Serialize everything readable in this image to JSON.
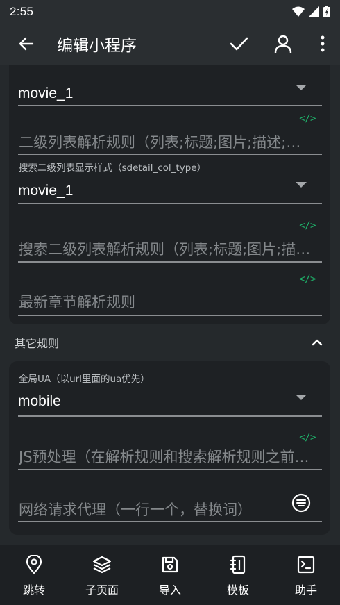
{
  "status_bar": {
    "time": "2:55"
  },
  "app_bar": {
    "title": "编辑小程序"
  },
  "card1": {
    "top_value": "movie_1",
    "rule_placeholder": "二级列表解析规则（列表;标题;图片;描述;链接）",
    "search_style_label": "搜索二级列表显示样式（sdetail_col_type）",
    "search_style_value": "movie_1",
    "search_rule_placeholder": "搜索二级列表解析规则（列表;标题;图片;描述;链接）",
    "latest_chapter_placeholder": "最新章节解析规则"
  },
  "code_icon_text": "</>",
  "section": {
    "title": "其它规则"
  },
  "card2": {
    "ua_label": "全局UA（以url里面的ua优先）",
    "ua_value": "mobile",
    "js_placeholder": "JS预处理（在解析规则和搜索解析规则之前执行）",
    "proxy_placeholder": "网络请求代理（一行一个，替换词）"
  },
  "bottom_nav": [
    {
      "label": "跳转",
      "icon": "map-pin-icon"
    },
    {
      "label": "子页面",
      "icon": "layers-icon"
    },
    {
      "label": "导入",
      "icon": "save-icon"
    },
    {
      "label": "模板",
      "icon": "notebook-icon"
    },
    {
      "label": "助手",
      "icon": "terminal-icon"
    }
  ],
  "colors": {
    "accent_green": "#1fb36b",
    "background": "#25292c",
    "card": "#1e2124"
  }
}
